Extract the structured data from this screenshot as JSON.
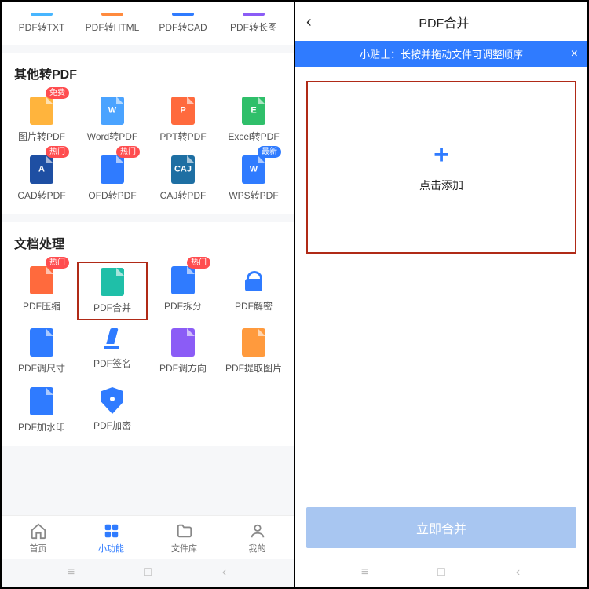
{
  "left": {
    "row1": [
      {
        "label": "PDF转TXT",
        "color": "#48b6ff"
      },
      {
        "label": "PDF转HTML",
        "color": "#ff8a3d"
      },
      {
        "label": "PDF转CAD",
        "color": "#2f7bff"
      },
      {
        "label": "PDF转长图",
        "color": "#8b5cf6"
      }
    ],
    "section2_title": "其他转PDF",
    "section2": [
      {
        "label": "图片转PDF",
        "letter": "",
        "color": "#ffb43d",
        "badge": "免费",
        "badge_class": "badge-red"
      },
      {
        "label": "Word转PDF",
        "letter": "W",
        "color": "#4aa3ff"
      },
      {
        "label": "PPT转PDF",
        "letter": "P",
        "color": "#ff6a3d"
      },
      {
        "label": "Excel转PDF",
        "letter": "E",
        "color": "#2fbf6a"
      },
      {
        "label": "CAD转PDF",
        "letter": "A",
        "color": "#1e4fa3",
        "badge": "热门",
        "badge_class": "badge-red"
      },
      {
        "label": "OFD转PDF",
        "letter": "",
        "color": "#2f7bff",
        "badge": "热门",
        "badge_class": "badge-red"
      },
      {
        "label": "CAJ转PDF",
        "letter": "CAJ",
        "color": "#1e6fa3"
      },
      {
        "label": "WPS转PDF",
        "letter": "W",
        "color": "#2f7bff",
        "badge": "最新",
        "badge_class": "badge-blue"
      }
    ],
    "section3_title": "文档处理",
    "section3": [
      {
        "label": "PDF压缩",
        "type": "doc",
        "color": "#ff6a3d",
        "badge": "热门",
        "badge_class": "badge-red"
      },
      {
        "label": "PDF合并",
        "type": "doc",
        "color": "#1fbfa8",
        "highlight": true
      },
      {
        "label": "PDF拆分",
        "type": "doc",
        "color": "#2f7bff",
        "badge": "热门",
        "badge_class": "badge-red"
      },
      {
        "label": "PDF解密",
        "type": "lock"
      },
      {
        "label": "PDF调尺寸",
        "type": "doc",
        "color": "#2f7bff"
      },
      {
        "label": "PDF签名",
        "type": "pen"
      },
      {
        "label": "PDF调方向",
        "type": "doc",
        "color": "#8b5cf6"
      },
      {
        "label": "PDF提取图片",
        "type": "doc",
        "color": "#ff9a3d"
      },
      {
        "label": "PDF加水印",
        "type": "doc",
        "color": "#2f7bff"
      },
      {
        "label": "PDF加密",
        "type": "shield"
      }
    ],
    "nav": [
      {
        "label": "首页",
        "icon": "home"
      },
      {
        "label": "小功能",
        "icon": "grid",
        "active": true
      },
      {
        "label": "文件库",
        "icon": "folder"
      },
      {
        "label": "我的",
        "icon": "user"
      }
    ]
  },
  "right": {
    "title": "PDF合并",
    "tip": "小贴士：长按并拖动文件可调整顺序",
    "add_label": "点击添加",
    "merge_label": "立即合并"
  }
}
